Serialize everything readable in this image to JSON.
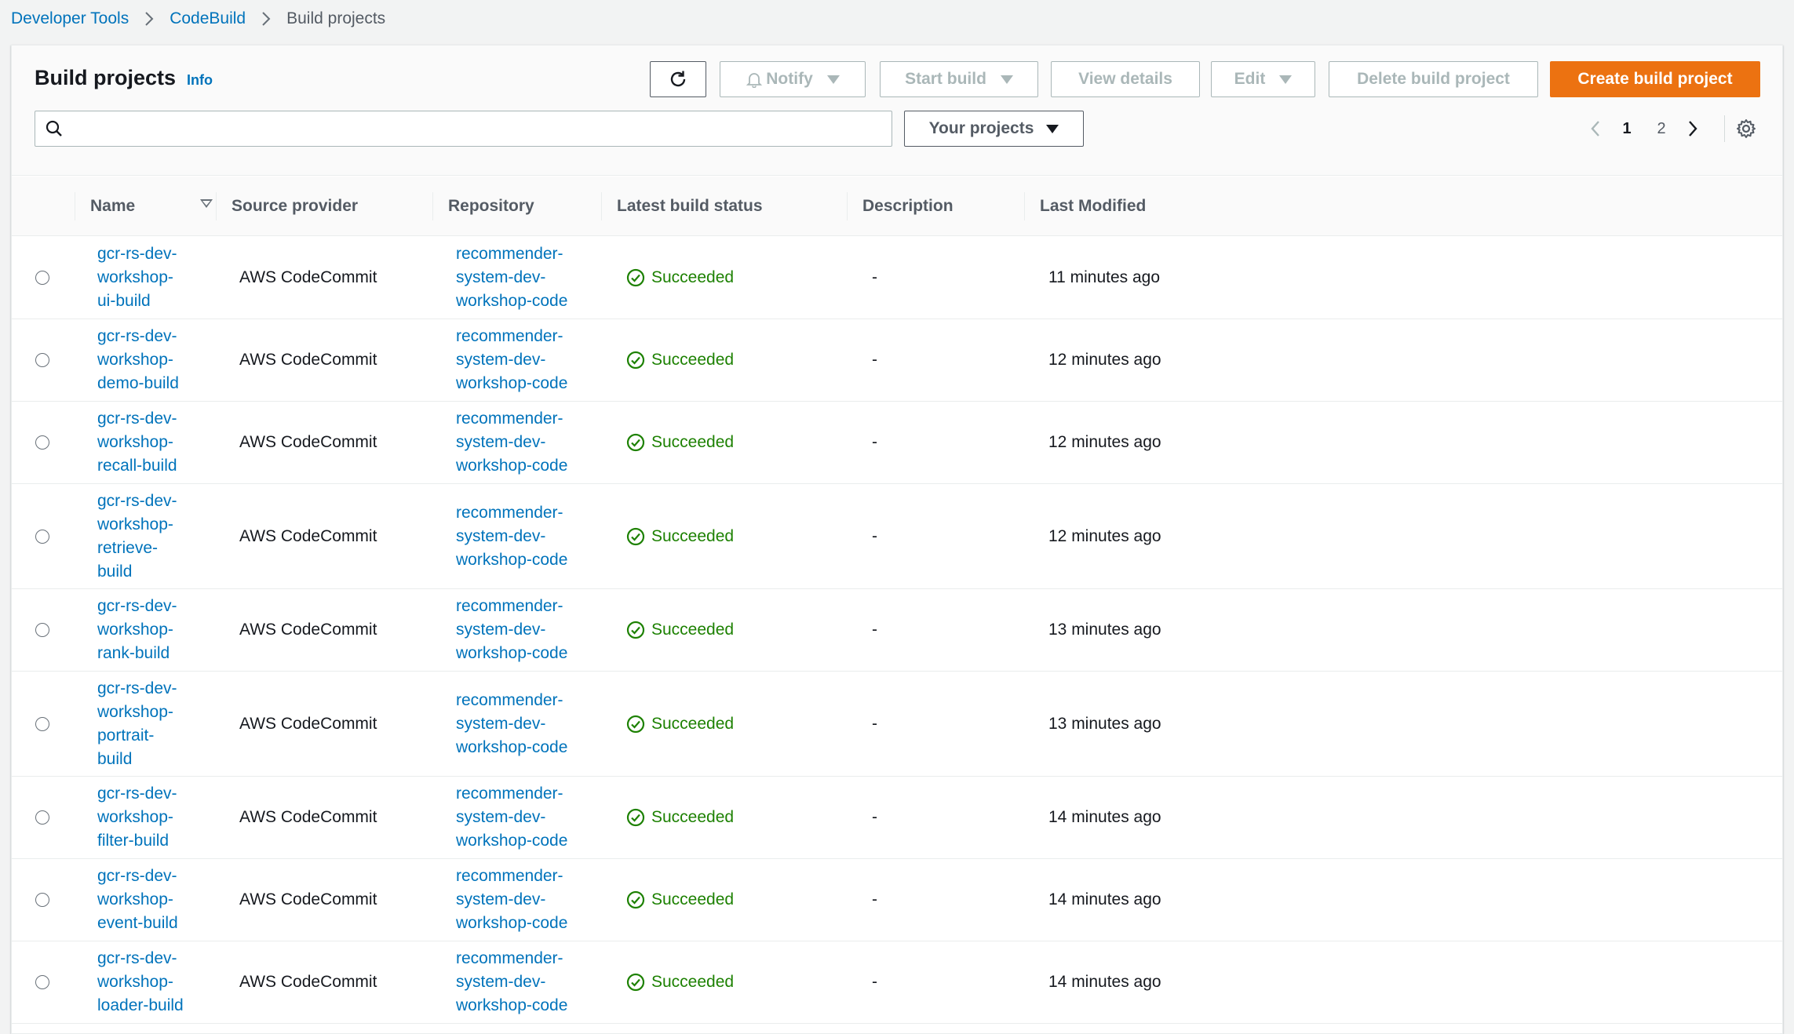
{
  "breadcrumb": [
    {
      "label": "Developer Tools"
    },
    {
      "label": "CodeBuild"
    },
    {
      "label": "Build projects"
    }
  ],
  "panel": {
    "title": "Build projects",
    "info": "Info"
  },
  "toolbar": {
    "notify": "Notify",
    "start_build": "Start build",
    "view_details": "View details",
    "edit": "Edit",
    "delete": "Delete build project",
    "create": "Create build project"
  },
  "search": {
    "value": "",
    "placeholder": ""
  },
  "filter": {
    "selected": "Your projects"
  },
  "pagination": {
    "pages": [
      "1",
      "2"
    ],
    "current": "1"
  },
  "columns": {
    "name": "Name",
    "source": "Source provider",
    "repository": "Repository",
    "status": "Latest build status",
    "description": "Description",
    "modified": "Last Modified"
  },
  "colors": {
    "accent": "#ec7211",
    "link": "#0073bb",
    "success": "#1d8102"
  },
  "rows": [
    {
      "name": [
        "gcr-rs-dev-",
        "workshop-",
        "ui-build"
      ],
      "source": "AWS CodeCommit",
      "repo": [
        "recommender-",
        "system-dev-",
        "workshop-code"
      ],
      "status": "Succeeded",
      "description": "-",
      "modified": "11 minutes ago"
    },
    {
      "name": [
        "gcr-rs-dev-",
        "workshop-",
        "demo-build"
      ],
      "source": "AWS CodeCommit",
      "repo": [
        "recommender-",
        "system-dev-",
        "workshop-code"
      ],
      "status": "Succeeded",
      "description": "-",
      "modified": "12 minutes ago"
    },
    {
      "name": [
        "gcr-rs-dev-",
        "workshop-",
        "recall-build"
      ],
      "source": "AWS CodeCommit",
      "repo": [
        "recommender-",
        "system-dev-",
        "workshop-code"
      ],
      "status": "Succeeded",
      "description": "-",
      "modified": "12 minutes ago"
    },
    {
      "name": [
        "gcr-rs-dev-",
        "workshop-",
        "retrieve-",
        "build"
      ],
      "source": "AWS CodeCommit",
      "repo": [
        "recommender-",
        "system-dev-",
        "workshop-code"
      ],
      "status": "Succeeded",
      "description": "-",
      "modified": "12 minutes ago"
    },
    {
      "name": [
        "gcr-rs-dev-",
        "workshop-",
        "rank-build"
      ],
      "source": "AWS CodeCommit",
      "repo": [
        "recommender-",
        "system-dev-",
        "workshop-code"
      ],
      "status": "Succeeded",
      "description": "-",
      "modified": "13 minutes ago"
    },
    {
      "name": [
        "gcr-rs-dev-",
        "workshop-",
        "portrait-",
        "build"
      ],
      "source": "AWS CodeCommit",
      "repo": [
        "recommender-",
        "system-dev-",
        "workshop-code"
      ],
      "status": "Succeeded",
      "description": "-",
      "modified": "13 minutes ago"
    },
    {
      "name": [
        "gcr-rs-dev-",
        "workshop-",
        "filter-build"
      ],
      "source": "AWS CodeCommit",
      "repo": [
        "recommender-",
        "system-dev-",
        "workshop-code"
      ],
      "status": "Succeeded",
      "description": "-",
      "modified": "14 minutes ago"
    },
    {
      "name": [
        "gcr-rs-dev-",
        "workshop-",
        "event-build"
      ],
      "source": "AWS CodeCommit",
      "repo": [
        "recommender-",
        "system-dev-",
        "workshop-code"
      ],
      "status": "Succeeded",
      "description": "-",
      "modified": "14 minutes ago"
    },
    {
      "name": [
        "gcr-rs-dev-",
        "workshop-",
        "loader-build"
      ],
      "source": "AWS CodeCommit",
      "repo": [
        "recommender-",
        "system-dev-",
        "workshop-code"
      ],
      "status": "Succeeded",
      "description": "-",
      "modified": "14 minutes ago"
    }
  ]
}
